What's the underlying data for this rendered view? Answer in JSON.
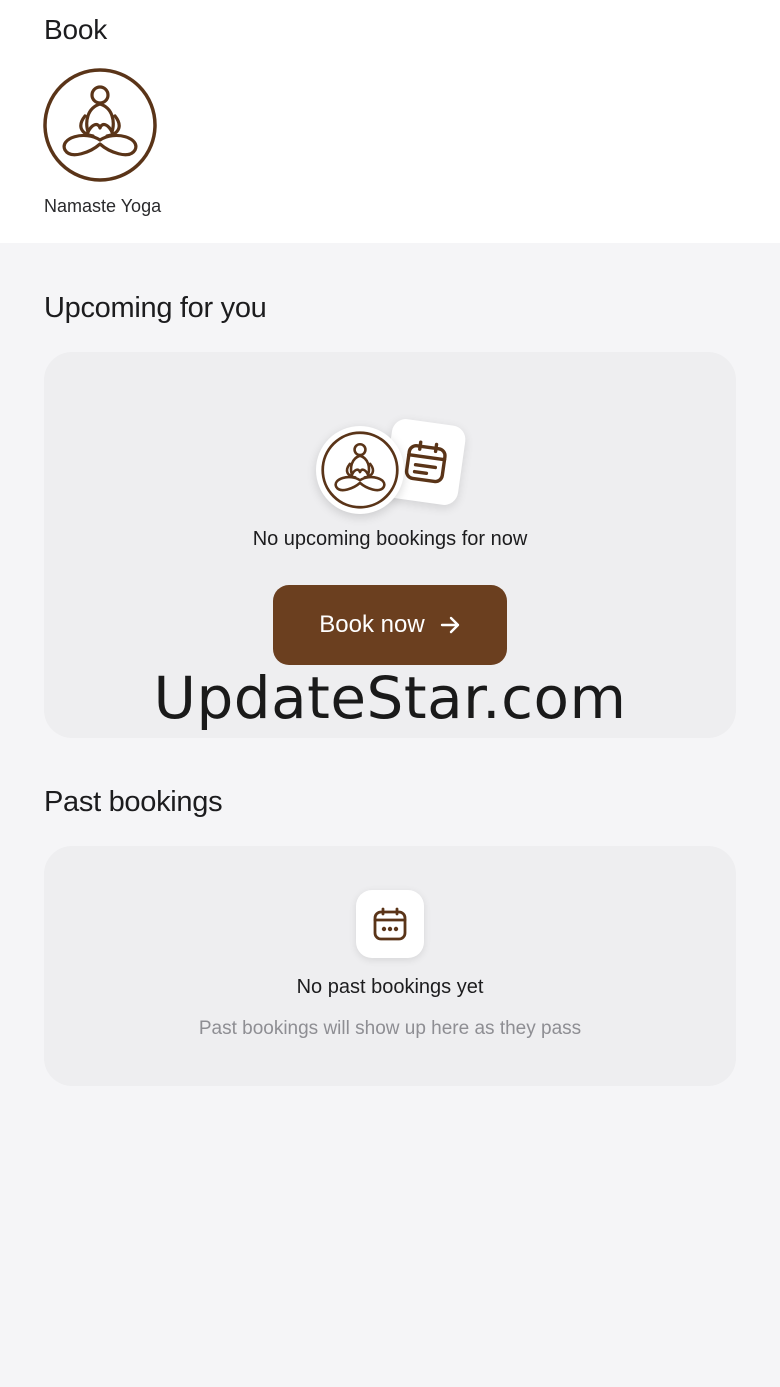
{
  "header": {
    "title": "Book"
  },
  "studio": {
    "name": "Namaste Yoga",
    "logo_icon": "meditation-logo-icon"
  },
  "upcoming": {
    "section_title": "Upcoming for you",
    "empty_title": "No upcoming bookings for now",
    "book_button_label": "Book now",
    "book_button_icon": "arrow-right-icon",
    "watermark": "UpdateStar.com"
  },
  "past": {
    "section_title": "Past bookings",
    "empty_title": "No past bookings yet",
    "empty_subtitle": "Past bookings will show up here as they pass",
    "icon": "calendar-icon"
  },
  "colors": {
    "brand": "#6b3f1f",
    "background": "#f5f5f7",
    "card": "#eeeef0"
  }
}
